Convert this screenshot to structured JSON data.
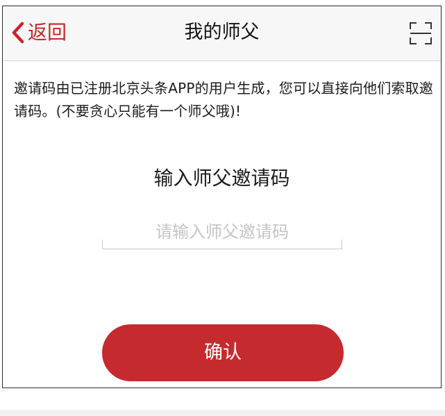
{
  "header": {
    "back_label": "返回",
    "title": "我的师父",
    "back_icon": "chevron-left-icon",
    "scan_icon": "scan-icon"
  },
  "main": {
    "description": "邀请码由已注册北京头条APP的用户生成，您可以直接向他们索取邀请码。(不要贪心只能有一个师父哦)!",
    "input_heading": "输入师父邀请码",
    "input_placeholder": "请输入师父邀请码",
    "input_value": "",
    "confirm_label": "确认"
  },
  "colors": {
    "accent": "#c8242b",
    "button": "#c52a2e",
    "navbar_bg": "#f7f7f7"
  }
}
